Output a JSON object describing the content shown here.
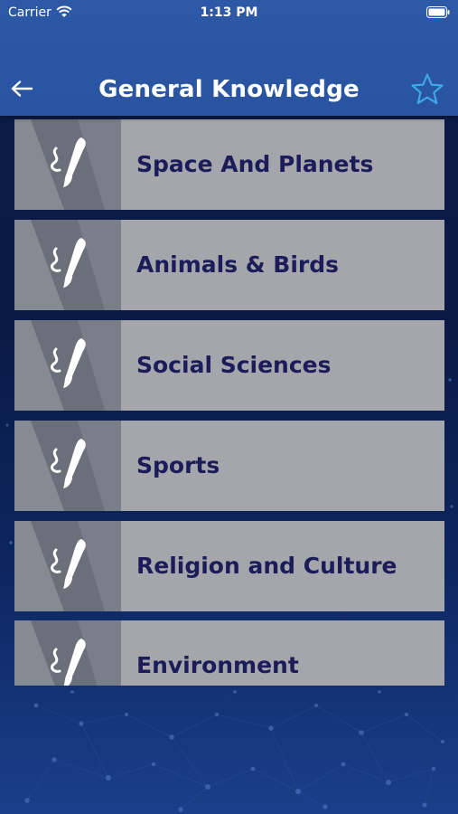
{
  "status_bar": {
    "carrier": "Carrier",
    "time": "1:13 PM"
  },
  "header": {
    "title": "General Knowledge",
    "back_icon": "arrow-left-icon",
    "favorite_icon": "star-outline-icon",
    "favorite_color": "#3fa6e8"
  },
  "categories": [
    {
      "label": "Space And Planets",
      "icon": "paintbrush-icon"
    },
    {
      "label": "Animals & Birds",
      "icon": "paintbrush-icon"
    },
    {
      "label": "Social Sciences",
      "icon": "paintbrush-icon"
    },
    {
      "label": "Sports",
      "icon": "paintbrush-icon"
    },
    {
      "label": "Religion and Culture",
      "icon": "paintbrush-icon"
    },
    {
      "label": "Environment",
      "icon": "paintbrush-icon"
    }
  ],
  "colors": {
    "header_bg": "#2c58a6",
    "card_bg": "#a5a6ab",
    "card_text": "#1c1c5a",
    "background": "#0c1c4a"
  }
}
